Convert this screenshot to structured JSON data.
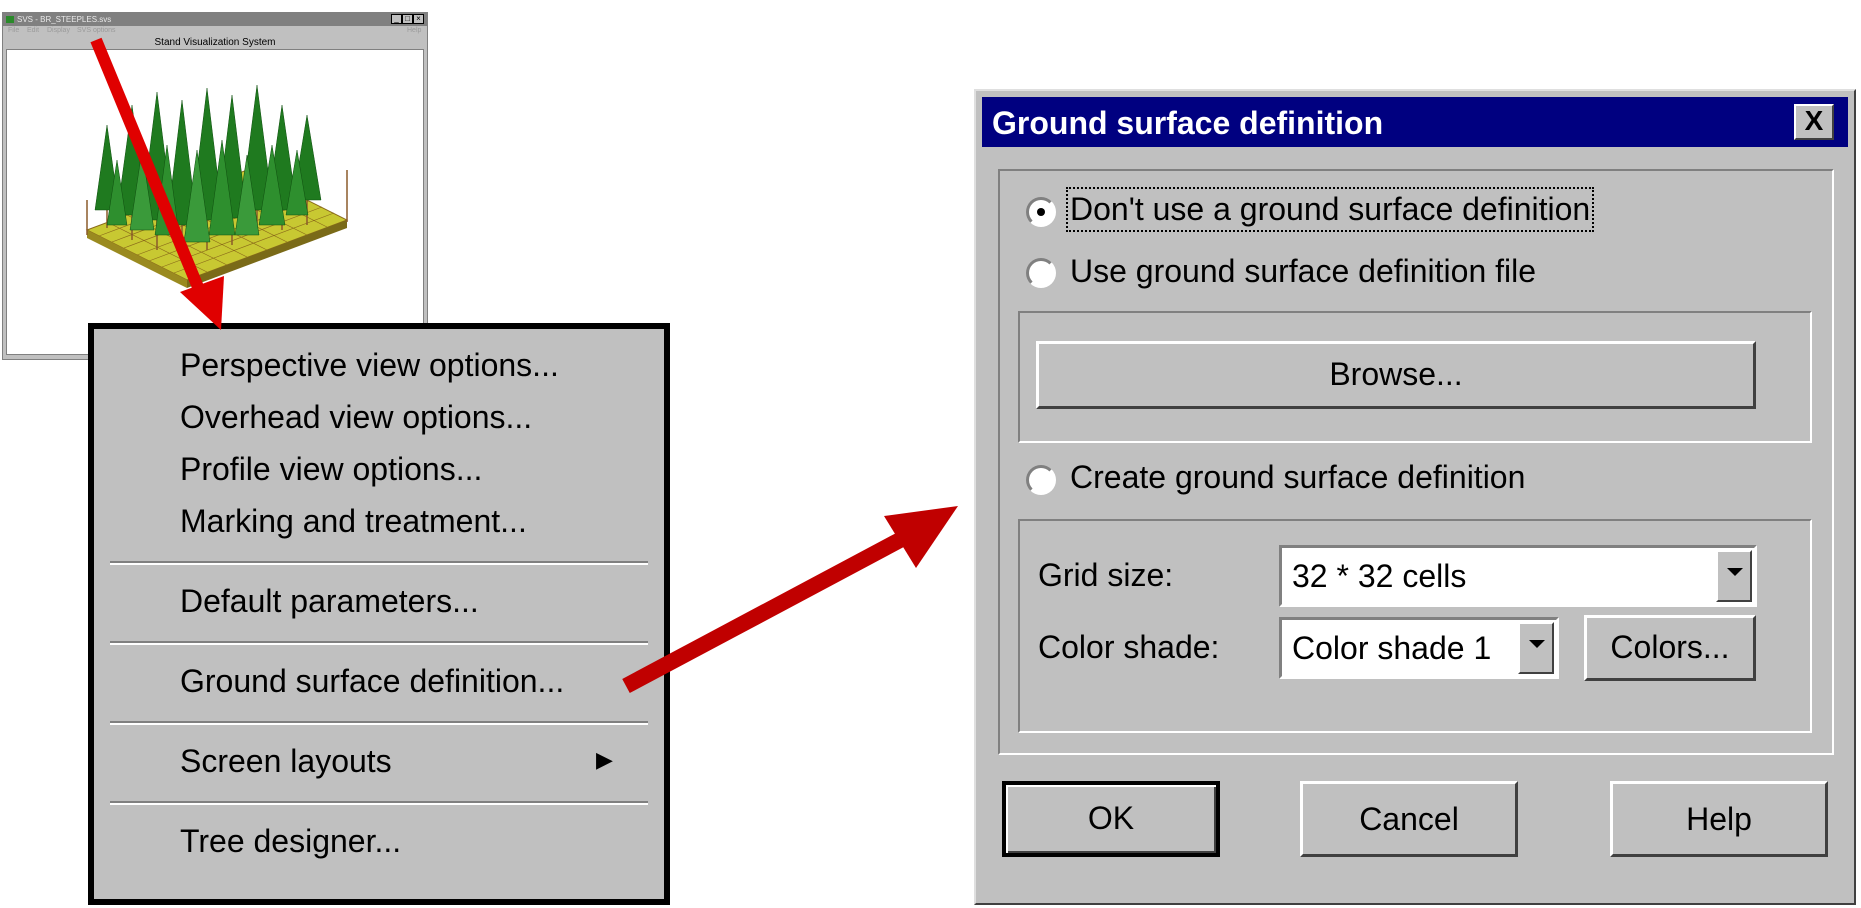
{
  "svs_window": {
    "title": "SVS - BR_STEEPLES.svs",
    "window_controls": [
      "_",
      "□",
      "×"
    ],
    "menu": [
      "File",
      "Edit",
      "Display",
      "SVS options"
    ],
    "help": "Help",
    "caption": "Stand Visualization System"
  },
  "context_menu": {
    "items": [
      {
        "label": "Perspective view options...",
        "accel": "P"
      },
      {
        "label": "Overhead view options...",
        "accel": "O"
      },
      {
        "label": "Profile view options...",
        "accel": "f"
      },
      {
        "label": "Marking and treatment...",
        "accel": "M"
      },
      {
        "label": "Default parameters...",
        "accel": "D"
      },
      {
        "label": "Ground surface definition...",
        "accel": "G"
      },
      {
        "label": "Screen layouts",
        "accel": "S",
        "submenu_arrow": "▶"
      },
      {
        "label": "Tree designer...",
        "accel": "T"
      }
    ]
  },
  "dialog": {
    "title": "Ground surface definition",
    "close_symbol": "X",
    "radio_options": [
      {
        "label": "Don't use a ground surface definition",
        "accel": "D",
        "selected": true
      },
      {
        "label": "Use ground surface definition file",
        "accel": "U",
        "selected": false
      },
      {
        "label": "Create ground surface definition",
        "accel": "C",
        "selected": false
      }
    ],
    "browse_label": "Browse...",
    "grid_size": {
      "label": "Grid size:",
      "accel": "G",
      "value": "32 * 32 cells"
    },
    "color_shade": {
      "label": "Color shade:",
      "accel": "s",
      "value": "Color shade 1"
    },
    "colors_label": "Colors...",
    "ok_label": "OK",
    "cancel_label": "Cancel",
    "help_label": "Help"
  },
  "colors": {
    "arrow": "#e00000",
    "arrow_dark": "#b00000",
    "title_bar": "#000080",
    "face": "#c0c0c0",
    "foliage": "#1f7a1f",
    "ground": "#c8c832"
  }
}
